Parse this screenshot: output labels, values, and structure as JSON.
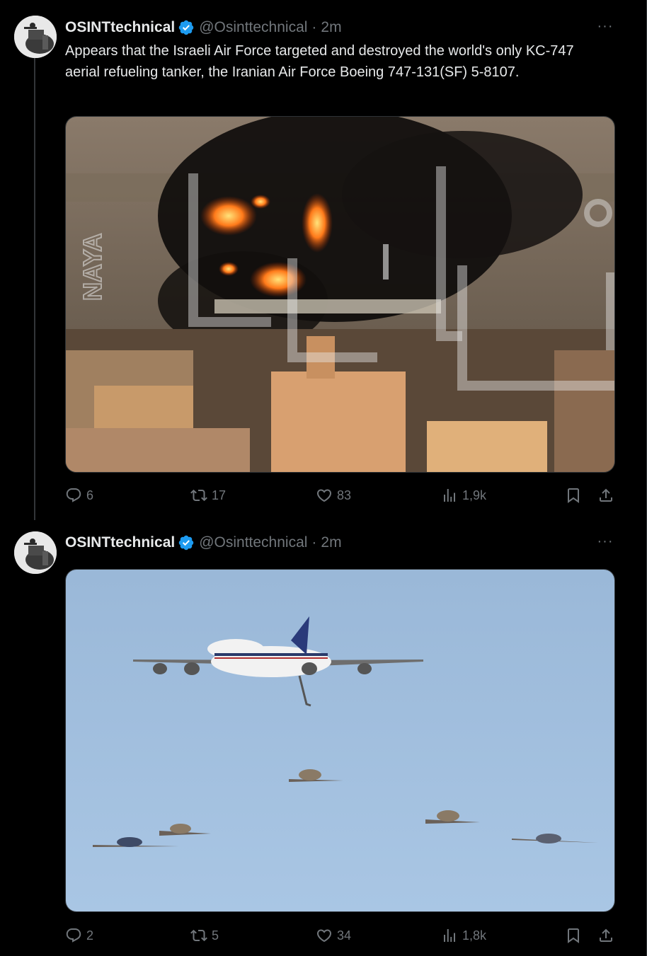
{
  "tweets": [
    {
      "author_name": "OSINTtechnical",
      "handle": "@Osinttechnical",
      "separator": "·",
      "time": "2m",
      "more": "···",
      "text": "Appears that the Israeli Air Force targeted and destroyed the world's only KC-747 aerial refueling tanker, the Iranian Air Force Boeing 747-131(SF) 5-8107.",
      "media_watermark": "NAYA",
      "actions": {
        "replies": "6",
        "reposts": "17",
        "likes": "83",
        "views": "1,9k"
      }
    },
    {
      "author_name": "OSINTtechnical",
      "handle": "@Osinttechnical",
      "separator": "·",
      "time": "2m",
      "more": "···",
      "text": "",
      "actions": {
        "replies": "2",
        "reposts": "5",
        "likes": "34",
        "views": "1,8k"
      }
    }
  ],
  "icons": {
    "verified": "verified-badge-icon",
    "reply": "reply-icon",
    "repost": "repost-icon",
    "like": "heart-icon",
    "views": "views-bar-chart-icon",
    "bookmark": "bookmark-icon",
    "share": "share-icon"
  },
  "colors": {
    "background": "#000000",
    "text": "#e7e9ea",
    "muted": "#71767b",
    "verified": "#1d9bf0",
    "border": "#2f3336"
  }
}
